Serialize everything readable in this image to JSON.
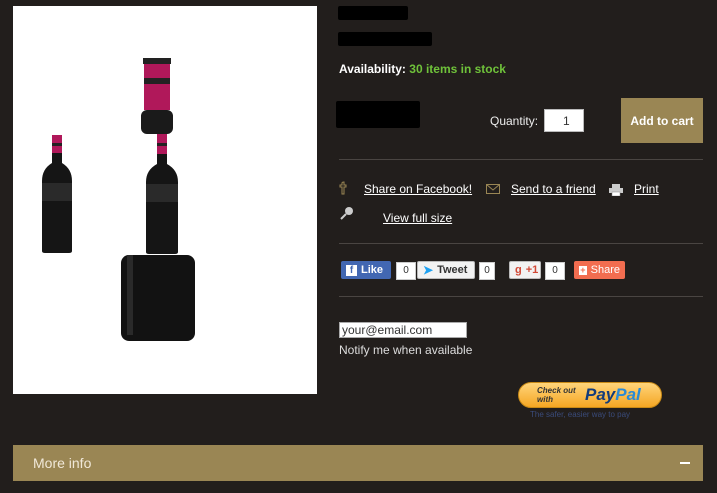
{
  "product": {
    "availability_label": "Availability:",
    "availability_value": "30 items in stock"
  },
  "cart": {
    "quantity_label": "Quantity:",
    "quantity_value": "1",
    "add_to_cart_label": "Add to cart"
  },
  "actions": {
    "share_facebook": "Share on Facebook!",
    "send_to_friend": "Send to a friend",
    "print": "Print",
    "view_full_size": "View full size"
  },
  "social": {
    "like_label": "Like",
    "like_count": "0",
    "tweet_label": "Tweet",
    "tweet_count": "0",
    "gplus_label": "+1",
    "gplus_count": "0",
    "share_label": "Share"
  },
  "notify": {
    "email_value": "your@email.com",
    "label": "Notify me when available"
  },
  "paypal": {
    "line1": "Check out",
    "line2": "with",
    "brand_pay": "Pay",
    "brand_pal": "Pal",
    "tagline": "The safer, easier way to pay"
  },
  "more_info": {
    "label": "More info"
  },
  "colors": {
    "background": "#221e1c",
    "accent_gold": "#9a8654",
    "stock_green": "#6fc23a"
  }
}
